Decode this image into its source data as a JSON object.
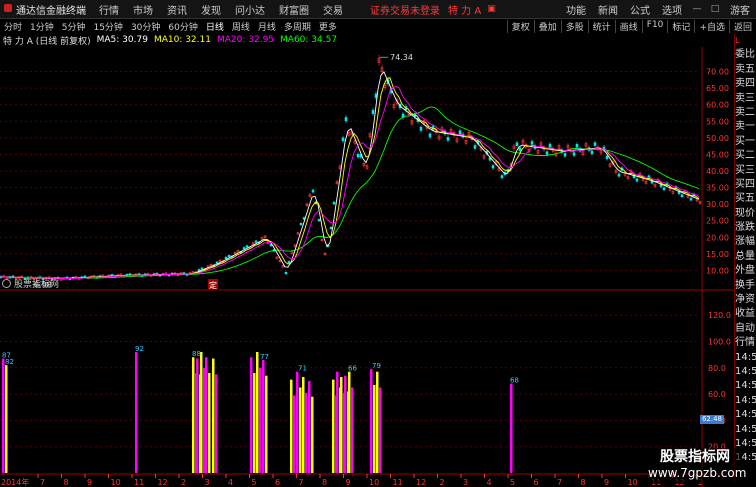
{
  "topbar": {
    "brand": "通达信金融终端",
    "menus": [
      "行情",
      "市场",
      "资讯",
      "发现",
      "问小达",
      "财富圈",
      "交易"
    ],
    "warning": "证券交易未登录",
    "stock_name": "特 力 A",
    "right_menus": [
      "功能",
      "新闻",
      "公式",
      "选项"
    ],
    "user": "游客"
  },
  "toolbar": {
    "periods": [
      "分时",
      "1分钟",
      "5分钟",
      "15分钟",
      "30分钟",
      "60分钟",
      "日线",
      "周线",
      "月线",
      "多周期",
      "更多"
    ],
    "active": "日线",
    "tools": [
      "复权",
      "叠加",
      "多股",
      "统计",
      "画线",
      "F10",
      "标记",
      "+自选",
      "返回"
    ]
  },
  "info": {
    "title": "特 力 A (日线 前复权)",
    "ma5": "MA5: 30.79",
    "ma10": "MA10: 32.11",
    "ma20": "MA20: 32.95",
    "ma60": "MA60: 34.57",
    "colors": {
      "ma5": "#ffffff",
      "ma10": "#ffff00",
      "ma20": "#ff00ff",
      "ma60": "#00ff00"
    }
  },
  "price_chart": {
    "high_label": "74.34",
    "low_label": "6.98",
    "marker": "定",
    "y_ticks": [
      "70.00",
      "65.00",
      "60.00",
      "55.00",
      "50.00",
      "45.00",
      "40.00",
      "35.00",
      "30.00",
      "25.00",
      "20.00",
      "15.00",
      "10.00"
    ]
  },
  "indicator": {
    "name": "股票指标网",
    "y_ticks": [
      "120.0",
      "100.0",
      "80.0",
      "60.0",
      "40.0",
      "20.0"
    ],
    "current_value": "62.48",
    "bar_labels": [
      "87",
      "82",
      "92",
      "88",
      "77",
      "71",
      "66",
      "79",
      "68"
    ]
  },
  "x_axis": {
    "year_label": "2014年",
    "months": [
      "7",
      "8",
      "9",
      "10",
      "11",
      "12",
      "2",
      "3",
      "4",
      "5",
      "6",
      "7",
      "8",
      "9",
      "10",
      "11",
      "12",
      "2",
      "3",
      "4",
      "5",
      "6",
      "7",
      "8",
      "9",
      "10",
      "11",
      "12",
      "2"
    ]
  },
  "side_panel": {
    "top_label": "L",
    "rows": [
      "委比",
      "卖五",
      "卖四",
      "卖三",
      "卖二",
      "卖一",
      "买一",
      "买二",
      "买三",
      "买四",
      "买五",
      "现价",
      "涨跌",
      "涨幅",
      "总量",
      "外盘",
      "换手",
      "净资",
      "收益"
    ],
    "lower_rows": [
      "自动",
      "行情",
      "14:5",
      "14:5",
      "14:5",
      "14:5",
      "14:5",
      "14:5",
      "14:5",
      "14:5",
      "14:5"
    ]
  },
  "watermark": {
    "line1": "股票指标网",
    "line2": "www.7gpzb.com"
  }
}
